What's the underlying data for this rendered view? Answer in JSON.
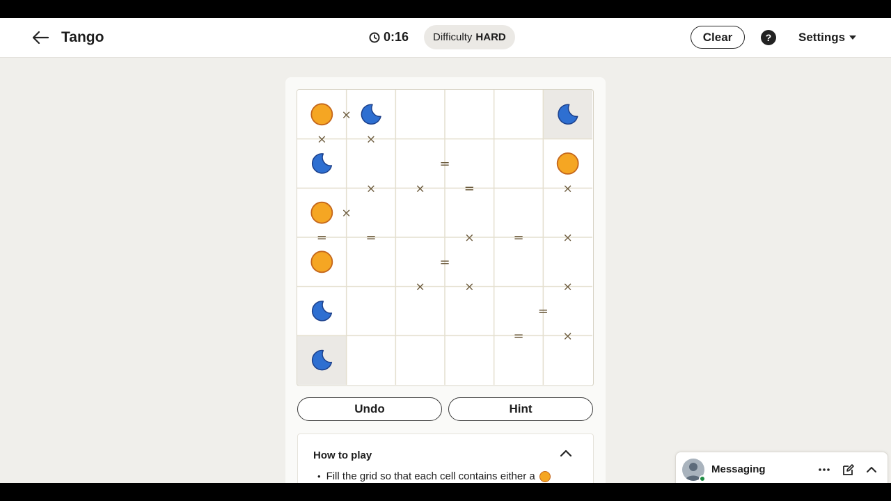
{
  "header": {
    "title": "Tango",
    "timer": "0:16",
    "difficulty_label": "Difficulty",
    "difficulty_value": "HARD",
    "clear_label": "Clear",
    "help_label": "?",
    "settings_label": "Settings"
  },
  "board": {
    "rows": 6,
    "cols": 6,
    "cells": [
      [
        "sun",
        "moon",
        "",
        "",
        "",
        "moon"
      ],
      [
        "moon",
        "",
        "",
        "",
        "",
        "sun"
      ],
      [
        "sun",
        "",
        "",
        "",
        "",
        ""
      ],
      [
        "sun",
        "",
        "",
        "",
        "",
        ""
      ],
      [
        "moon",
        "",
        "",
        "",
        "",
        ""
      ],
      [
        "moon",
        "",
        "",
        "",
        "",
        ""
      ]
    ],
    "locked": [
      [
        0,
        5
      ],
      [
        5,
        0
      ]
    ],
    "h_constraints": [
      {
        "row": 0,
        "col": 0,
        "sign": "×"
      },
      {
        "row": 1,
        "col": 2,
        "sign": "="
      },
      {
        "row": 2,
        "col": 0,
        "sign": "×"
      },
      {
        "row": 3,
        "col": 2,
        "sign": "="
      },
      {
        "row": 4,
        "col": 4,
        "sign": "="
      }
    ],
    "v_constraints": [
      {
        "row": 0,
        "col": 0,
        "sign": "×"
      },
      {
        "row": 0,
        "col": 1,
        "sign": "×"
      },
      {
        "row": 1,
        "col": 1,
        "sign": "×"
      },
      {
        "row": 1,
        "col": 2,
        "sign": "×"
      },
      {
        "row": 1,
        "col": 3,
        "sign": "="
      },
      {
        "row": 1,
        "col": 5,
        "sign": "×"
      },
      {
        "row": 2,
        "col": 0,
        "sign": "="
      },
      {
        "row": 2,
        "col": 1,
        "sign": "="
      },
      {
        "row": 2,
        "col": 3,
        "sign": "×"
      },
      {
        "row": 2,
        "col": 4,
        "sign": "="
      },
      {
        "row": 2,
        "col": 5,
        "sign": "×"
      },
      {
        "row": 3,
        "col": 2,
        "sign": "×"
      },
      {
        "row": 3,
        "col": 3,
        "sign": "×"
      },
      {
        "row": 3,
        "col": 5,
        "sign": "×"
      },
      {
        "row": 4,
        "col": 4,
        "sign": "="
      },
      {
        "row": 4,
        "col": 5,
        "sign": "×"
      }
    ],
    "colors": {
      "sun_fill": "#f5a623",
      "sun_stroke": "#c4661b",
      "moon_fill": "#2e6fd1",
      "moon_stroke": "#1b3f8a",
      "locked_bg": "#ebe9e5",
      "grid_line": "#e4dfcf",
      "constraint": "#6b5a3c"
    }
  },
  "actions": {
    "undo_label": "Undo",
    "hint_label": "Hint"
  },
  "how_to_play": {
    "title": "How to play",
    "rule_1": "Fill the grid so that each cell contains either a"
  },
  "messaging": {
    "label": "Messaging"
  }
}
